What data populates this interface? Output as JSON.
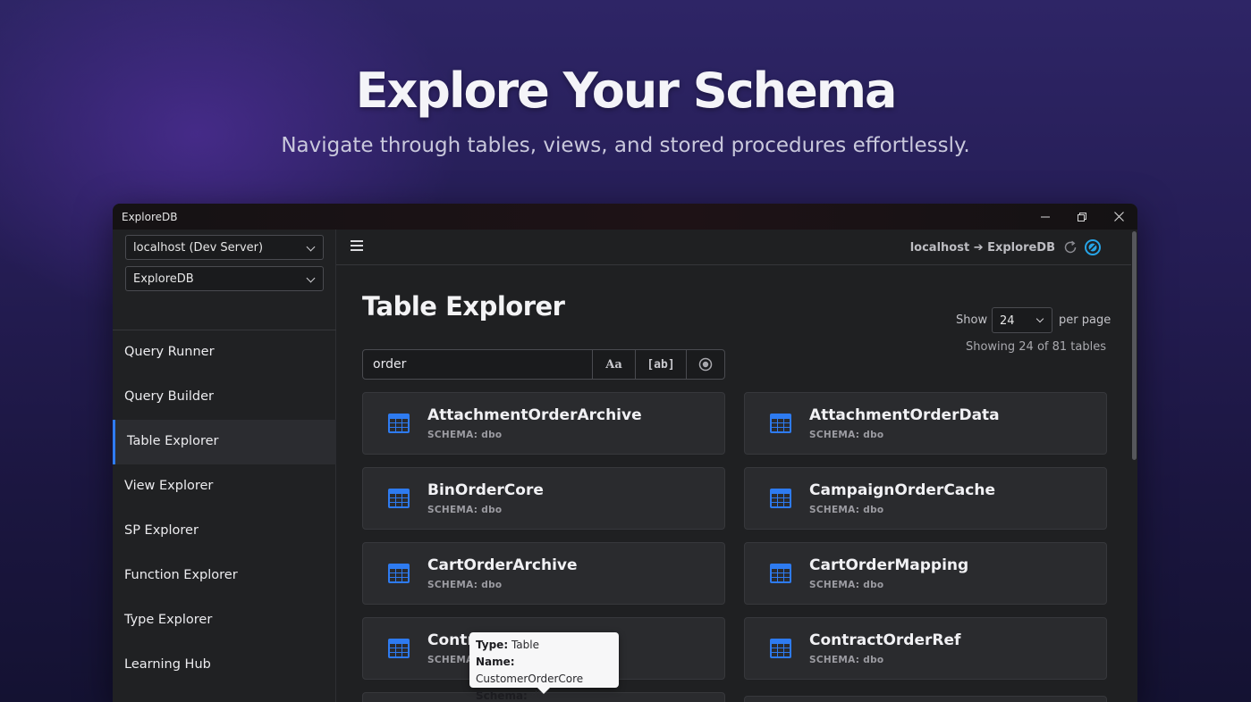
{
  "hero": {
    "title": "Explore Your Schema",
    "subtitle": "Navigate through tables, views, and stored procedures effortlessly."
  },
  "window": {
    "title": "ExploreDB",
    "controls": {
      "minimize": "—",
      "restore": "❐",
      "close": "✕"
    }
  },
  "sidebar": {
    "server_select": "localhost (Dev Server)",
    "database_select": "ExploreDB",
    "items": [
      {
        "label": "Query Runner",
        "active": false
      },
      {
        "label": "Query Builder",
        "active": false
      },
      {
        "label": "Table Explorer",
        "active": true
      },
      {
        "label": "View Explorer",
        "active": false
      },
      {
        "label": "SP Explorer",
        "active": false
      },
      {
        "label": "Function Explorer",
        "active": false
      },
      {
        "label": "Type Explorer",
        "active": false
      },
      {
        "label": "Learning Hub",
        "active": false
      }
    ]
  },
  "topbar": {
    "connection": "localhost ➔ ExploreDB",
    "icons": [
      "menu-icon",
      "refresh-icon",
      "connection-status-icon"
    ]
  },
  "main": {
    "page_title": "Table Explorer",
    "show_label": "Show",
    "per_page_value": "24",
    "per_page_label": "per page",
    "showing": "Showing 24 of 81 tables",
    "search": {
      "value": "order",
      "match_case_label": "Aa",
      "whole_word_label": "[ab]",
      "regex_icon": "target-icon"
    },
    "cards": [
      {
        "name": "AttachmentOrderArchive",
        "schema": "SCHEMA: dbo"
      },
      {
        "name": "AttachmentOrderData",
        "schema": "SCHEMA: dbo"
      },
      {
        "name": "BinOrderCore",
        "schema": "SCHEMA: dbo"
      },
      {
        "name": "CampaignOrderCache",
        "schema": "SCHEMA: dbo"
      },
      {
        "name": "CartOrderArchive",
        "schema": "SCHEMA: dbo"
      },
      {
        "name": "CartOrderMapping",
        "schema": "SCHEMA: dbo"
      },
      {
        "name": "ContractOrderLog",
        "schema": "SCHEMA: dbo"
      },
      {
        "name": "ContractOrderRef",
        "schema": "SCHEMA: dbo"
      }
    ]
  },
  "tooltip": {
    "type_label": "Type:",
    "type_value": "Table",
    "name_label": "Name:",
    "name_value": "CustomerOrderCore",
    "schema_label": "Schema:",
    "schema_value": "dbo"
  },
  "colors": {
    "accent": "#2f7cf6",
    "table_icon": "#2e7bf0",
    "status_icon": "#27a5e8"
  }
}
